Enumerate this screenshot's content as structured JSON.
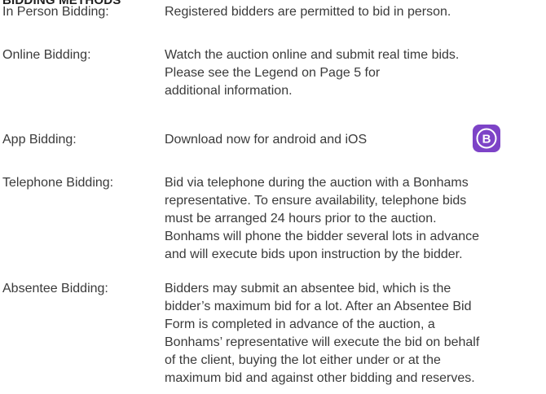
{
  "section": {
    "heading": "BIDDING METHODS"
  },
  "methods": [
    {
      "term": "In Person Bidding:",
      "lines": [
        "Registered bidders are permitted to bid in person."
      ]
    },
    {
      "term": "Online Bidding:",
      "lines": [
        "Watch the auction online and submit real time bids.",
        "Please see the Legend on Page 5 for",
        "additional information."
      ]
    },
    {
      "term": "App Bidding:",
      "lines": [
        "Download now for android and iOS"
      ],
      "app_icon": {
        "icon": "bonhams-app-icon",
        "letter": "B",
        "color": "#7d43c7"
      }
    },
    {
      "term": "Telephone Bidding:",
      "lines": [
        "Bid via telephone during the auction with a Bonhams",
        "representative. To ensure availability, telephone bids",
        "must be arranged 24 hours prior to the auction.",
        "Bonhams will phone the bidder several lots in advance",
        "and will execute bids upon instruction by the bidder."
      ]
    },
    {
      "term": "Absentee Bidding:",
      "lines": [
        "Bidders may submit an absentee bid, which is the",
        "bidder’s maximum bid for a lot. After an Absentee Bid",
        "Form is completed in advance of the auction, a",
        "Bonhams’ representative will execute the bid on behalf",
        "of the client, buying the lot either under or at the",
        "maximum bid and against other bidding and reserves."
      ]
    }
  ]
}
